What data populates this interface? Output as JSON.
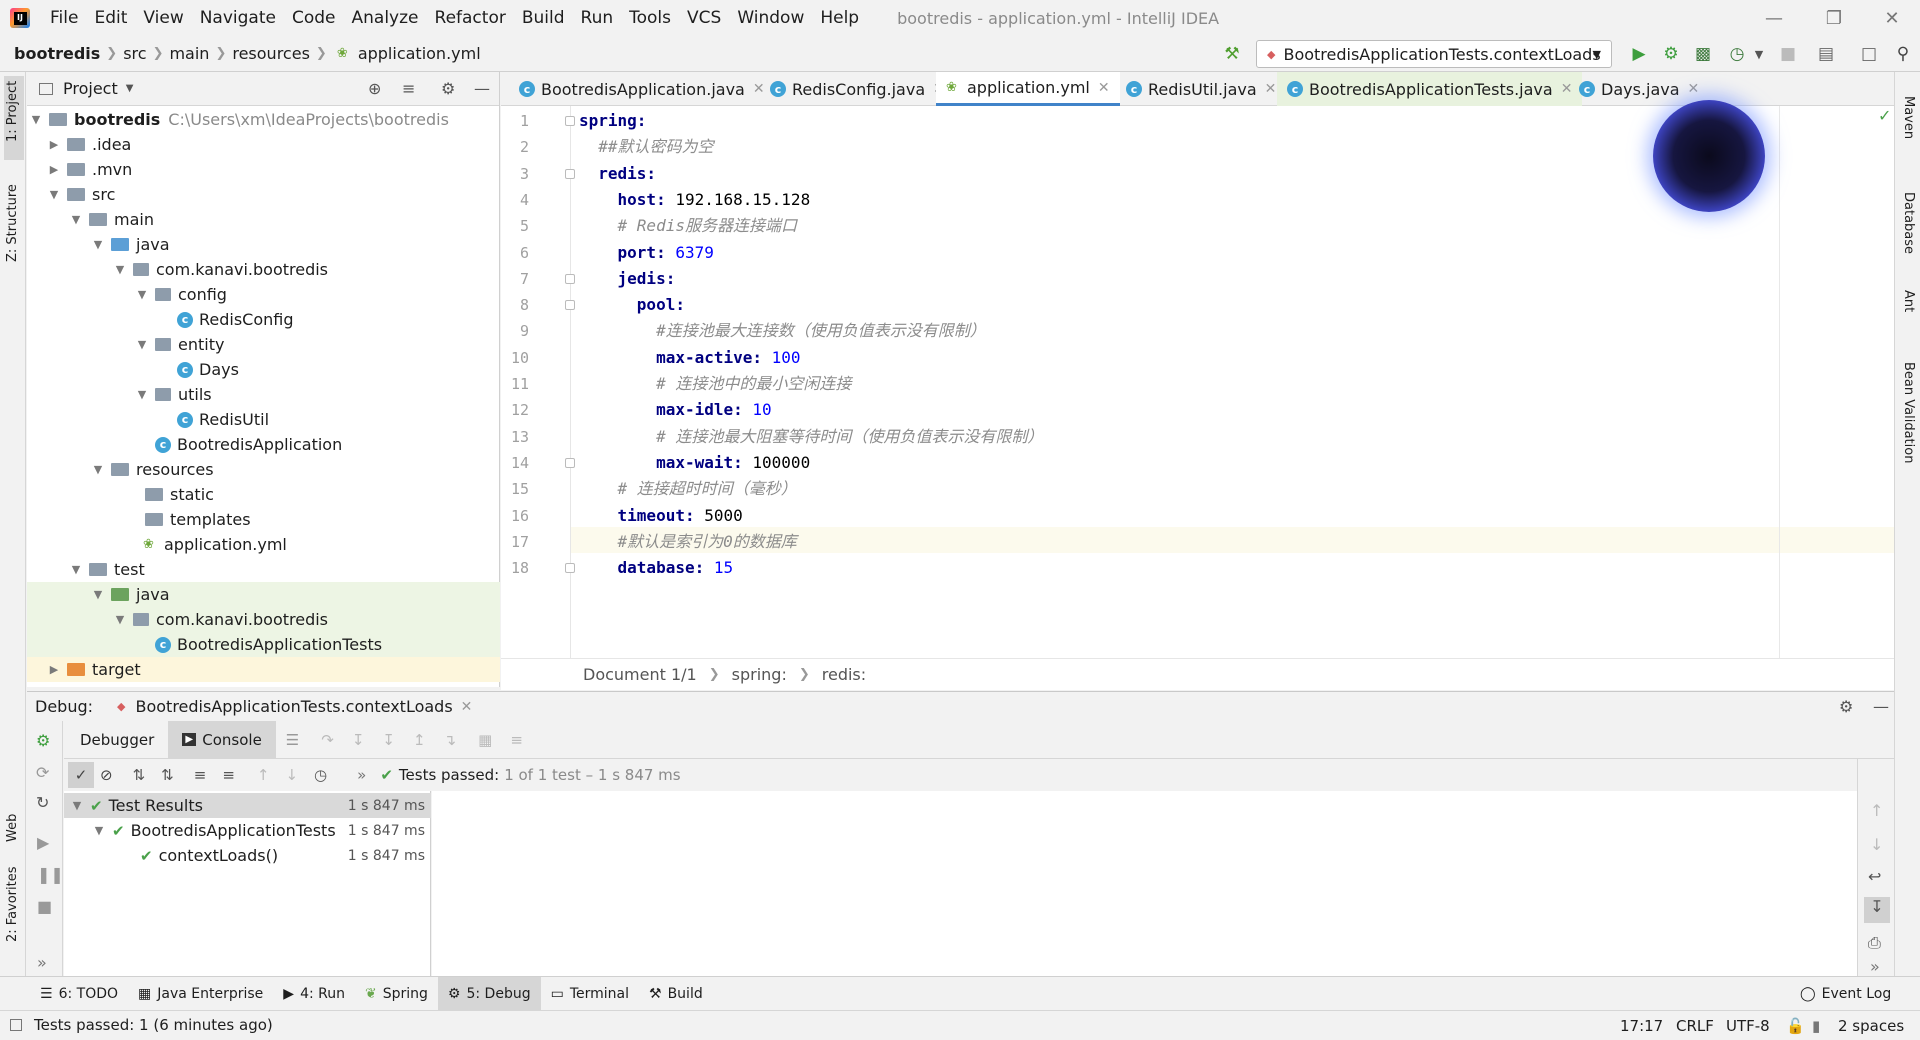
{
  "menu": [
    "File",
    "Edit",
    "View",
    "Navigate",
    "Code",
    "Analyze",
    "Refactor",
    "Build",
    "Run",
    "Tools",
    "VCS",
    "Window",
    "Help"
  ],
  "window_title": "bootredis - application.yml - IntelliJ IDEA",
  "breadcrumbs": [
    "bootredis",
    "src",
    "main",
    "resources",
    "application.yml"
  ],
  "run_config": "BootredisApplicationTests.contextLoads",
  "left_stripe": {
    "project": "1: Project",
    "structure": "Z: Structure",
    "web": "Web",
    "favorites": "2: Favorites"
  },
  "right_stripe": {
    "maven": "Maven",
    "database": "Database",
    "ant": "Ant",
    "bean": "Bean Validation"
  },
  "project_panel": {
    "title": "Project",
    "root_name": "bootredis",
    "root_path": "C:\\Users\\xm\\IdeaProjects\\bootredis",
    "items": [
      ".idea",
      ".mvn",
      "src",
      "main",
      "java",
      "com.kanavi.bootredis",
      "config",
      "RedisConfig",
      "entity",
      "Days",
      "utils",
      "RedisUtil",
      "BootredisApplication",
      "resources",
      "static",
      "templates",
      "application.yml",
      "test",
      "java",
      "com.kanavi.bootredis",
      "BootredisApplicationTests",
      "target"
    ]
  },
  "editor_tabs": [
    "BootredisApplication.java",
    "RedisConfig.java",
    "application.yml",
    "RedisUtil.java",
    "BootredisApplicationTests.java",
    "Days.java"
  ],
  "code_lines": [
    {
      "n": "1",
      "key": "spring:",
      "val": "",
      "type": "k"
    },
    {
      "n": "2",
      "key": "",
      "val": "  ##默认密码为空",
      "type": "c"
    },
    {
      "n": "3",
      "key": "  redis:",
      "val": "",
      "type": "k"
    },
    {
      "n": "4",
      "key": "    host:",
      "val": " 192.168.15.128",
      "type": "kv"
    },
    {
      "n": "5",
      "key": "",
      "val": "    # Redis服务器连接端口",
      "type": "c"
    },
    {
      "n": "6",
      "key": "    port:",
      "val": " 6379",
      "type": "kn"
    },
    {
      "n": "7",
      "key": "    jedis:",
      "val": "",
      "type": "k"
    },
    {
      "n": "8",
      "key": "      pool:",
      "val": "",
      "type": "k"
    },
    {
      "n": "9",
      "key": "",
      "val": "        #连接池最大连接数（使用负值表示没有限制）",
      "type": "c"
    },
    {
      "n": "10",
      "key": "        max-active:",
      "val": " 100",
      "type": "kn"
    },
    {
      "n": "11",
      "key": "",
      "val": "        # 连接池中的最小空闲连接",
      "type": "c"
    },
    {
      "n": "12",
      "key": "        max-idle:",
      "val": " 10",
      "type": "kn"
    },
    {
      "n": "13",
      "key": "",
      "val": "        # 连接池最大阻塞等待时间（使用负值表示没有限制）",
      "type": "c"
    },
    {
      "n": "14",
      "key": "        max-wait:",
      "val": " 100000",
      "type": "kv"
    },
    {
      "n": "15",
      "key": "",
      "val": "    # 连接超时时间（毫秒）",
      "type": "c"
    },
    {
      "n": "16",
      "key": "    timeout:",
      "val": " 5000",
      "type": "kv"
    },
    {
      "n": "17",
      "key": "",
      "val": "    #默认是索引为0的数据库",
      "type": "c"
    },
    {
      "n": "18",
      "key": "    database:",
      "val": " 15",
      "type": "kn"
    }
  ],
  "editor_crumb": [
    "Document 1/1",
    "spring:",
    "redis:"
  ],
  "debug": {
    "label": "Debug:",
    "session": "BootredisApplicationTests.contextLoads",
    "tab_debugger": "Debugger",
    "tab_console": "Console",
    "status_passed": "Tests passed:",
    "status_detail": "1 of 1 test – 1 s 847 ms",
    "tests": [
      {
        "name": "Test Results",
        "time": "1 s 847 ms"
      },
      {
        "name": "BootredisApplicationTests",
        "time": "1 s 847 ms"
      },
      {
        "name": "contextLoads()",
        "time": "1 s 847 ms"
      }
    ]
  },
  "bottom_tools": {
    "todo": "6: TODO",
    "enterprise": "Java Enterprise",
    "run": "4: Run",
    "spring": "Spring",
    "debug": "5: Debug",
    "terminal": "Terminal",
    "build": "Build",
    "event_log": "Event Log"
  },
  "status": {
    "message": "Tests passed: 1 (6 minutes ago)",
    "position": "17:17",
    "line_sep": "CRLF",
    "encoding": "UTF-8",
    "indent": "2 spaces"
  }
}
